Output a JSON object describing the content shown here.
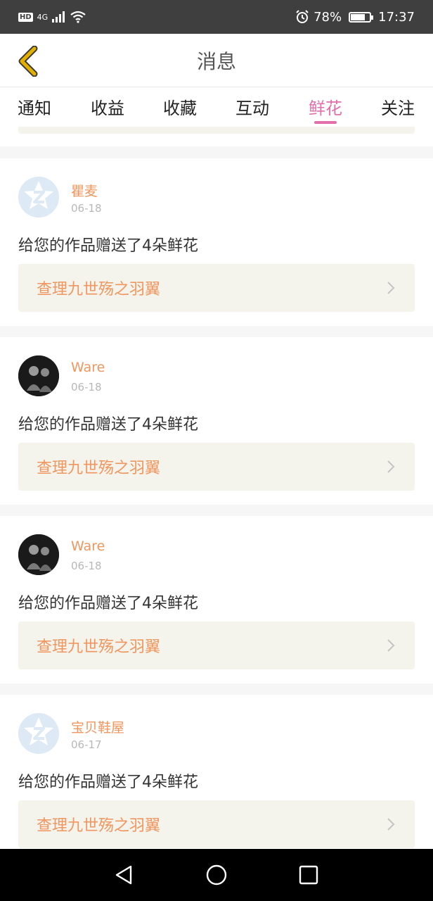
{
  "status_bar": {
    "hd": "HD",
    "network": "4G",
    "battery_percent": "78%",
    "battery_level": 0.78,
    "time": "17:37"
  },
  "header": {
    "title": "消息",
    "back_icon": "chevron-left-icon"
  },
  "tabs": {
    "items": [
      {
        "label": "通知"
      },
      {
        "label": "收益"
      },
      {
        "label": "收藏"
      },
      {
        "label": "互动"
      },
      {
        "label": "鲜花"
      },
      {
        "label": "关注"
      }
    ],
    "active_index": 4,
    "active_color": "#e26fa9"
  },
  "messages": [
    {
      "username": "瞿麦",
      "date": "06-18",
      "avatar": "default-qq-avatar",
      "text": "给您的作品赠送了4朵鲜花",
      "work_title": "查理九世殇之羽翼"
    },
    {
      "username": "Ware",
      "date": "06-18",
      "avatar": "photo-avatar",
      "text": "给您的作品赠送了4朵鲜花",
      "work_title": "查理九世殇之羽翼"
    },
    {
      "username": "Ware",
      "date": "06-18",
      "avatar": "photo-avatar",
      "text": "给您的作品赠送了4朵鲜花",
      "work_title": "查理九世殇之羽翼"
    },
    {
      "username": "宝贝鞋屋",
      "date": "06-17",
      "avatar": "default-qq-avatar",
      "text": "给您的作品赠送了4朵鲜花",
      "work_title": "查理九世殇之羽翼"
    }
  ],
  "colors": {
    "accent_orange": "#f0965e",
    "link_bg": "#f4f3ec",
    "back_icon": "#e4b000"
  },
  "nav_bar": {
    "back": "triangle-back-icon",
    "home": "circle-home-icon",
    "recents": "square-recents-icon"
  }
}
